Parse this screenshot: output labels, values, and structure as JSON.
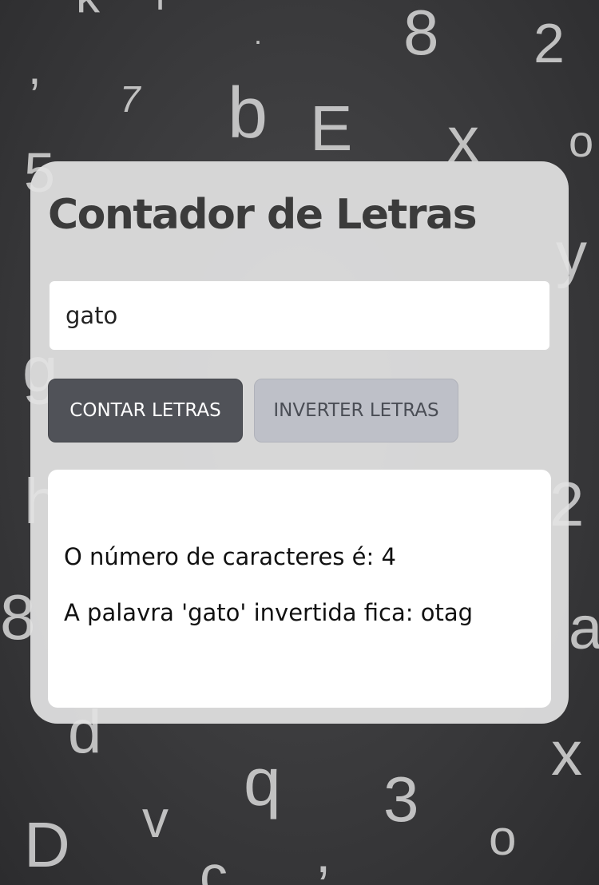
{
  "app": {
    "title": "Contador de Letras"
  },
  "input": {
    "value": "gato",
    "placeholder": ""
  },
  "buttons": {
    "count_label": "CONTAR LETRAS",
    "invert_label": "INVERTER LETRAS"
  },
  "result": {
    "count_text": "O número de caracteres é: 4",
    "reverse_text": "A palavra 'gato' invertida fica: otag"
  },
  "colors": {
    "background": "#3a3a3c",
    "card": "#e2e2e2",
    "primary_button": "#505258",
    "secondary_button": "#bec0c8",
    "title_text": "#3b3b3b"
  }
}
